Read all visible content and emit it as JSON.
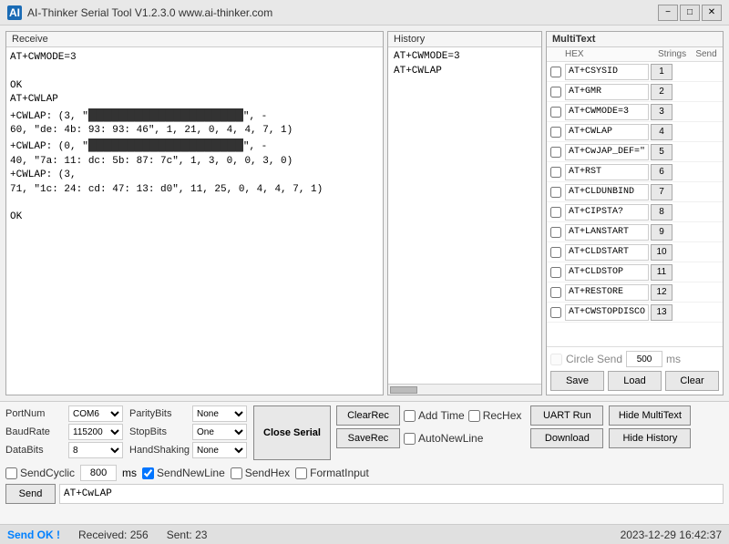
{
  "titleBar": {
    "title": "AI-Thinker Serial Tool V1.2.3.0   www.ai-thinker.com",
    "minimizeIcon": "−",
    "maximizeIcon": "□",
    "closeIcon": "✕"
  },
  "receive": {
    "panelTitle": "Receive",
    "content": "AT+CWMODE=3\r\n\r\nOK\r\nAT+CWLAP\r\n+CWLAP: (3, \"[REDACTED]\", -\r\n60, \"de: 4b: 93: 93: 46\", 1, 21, 0, 4, 4, 7, 1)\r\n+CWLAP: (0, \"[REDACTED]\", -\r\n40, \"7a: 11: dc: 5b: 87: 7c\", 1, 3, 0, 0, 3, 0)\r\n+CWLAP: (3,\r\n71, \"1c: 24: cd: 47: 13: d0\", 11, 25, 0, 4, 4, 7, 1)\r\n\r\nOK"
  },
  "history": {
    "panelTitle": "History",
    "items": [
      "AT+CWMODE=3",
      "AT+CWLAP"
    ]
  },
  "multitext": {
    "panelTitle": "MultiText",
    "colHex": "HEX",
    "colStrings": "Strings",
    "colSend": "Send",
    "rows": [
      {
        "hex": false,
        "value": "AT+CSYSID",
        "sendNum": "1"
      },
      {
        "hex": false,
        "value": "AT+GMR",
        "sendNum": "2"
      },
      {
        "hex": false,
        "value": "AT+CWMODE=3",
        "sendNum": "3"
      },
      {
        "hex": false,
        "value": "AT+CWLAP",
        "sendNum": "4"
      },
      {
        "hex": false,
        "value": "AT+CwJAP_DEF=\"newifi_",
        "sendNum": "5"
      },
      {
        "hex": false,
        "value": "AT+RST",
        "sendNum": "6"
      },
      {
        "hex": false,
        "value": "AT+CLDUNBIND",
        "sendNum": "7"
      },
      {
        "hex": false,
        "value": "AT+CIPSTA?",
        "sendNum": "8"
      },
      {
        "hex": false,
        "value": "AT+LANSTART",
        "sendNum": "9"
      },
      {
        "hex": false,
        "value": "AT+CLDSTART",
        "sendNum": "10"
      },
      {
        "hex": false,
        "value": "AT+CLDSTOP",
        "sendNum": "11"
      },
      {
        "hex": false,
        "value": "AT+RESTORE",
        "sendNum": "12"
      },
      {
        "hex": false,
        "value": "AT+CWSTOPDISCOVER",
        "sendNum": "13"
      }
    ],
    "circleSend": {
      "label": "Circle Send",
      "value": "500",
      "unit": "ms"
    },
    "buttons": {
      "save": "Save",
      "load": "Load",
      "clear": "Clear"
    }
  },
  "bottomControls": {
    "params": {
      "portNum": {
        "label": "PortNum",
        "value": "COM6"
      },
      "baudRate": {
        "label": "BaudRate",
        "value": "115200"
      },
      "dataBits": {
        "label": "DataBits",
        "value": "8"
      },
      "parityBits": {
        "label": "ParityBits",
        "value": "None"
      },
      "stopBits": {
        "label": "StopBits",
        "value": "One"
      },
      "handShaking": {
        "label": "HandShaking",
        "value": "None"
      }
    },
    "closeSerial": "Close Serial",
    "clearRec": "ClearRec",
    "saveRec": "SaveRec",
    "addTime": "Add Time",
    "recHex": "RecHex",
    "autoNewLine": "AutoNewLine",
    "uartRun": "UART Run",
    "download": "Download",
    "hideMultiText": "Hide MultiText",
    "hideHistory": "Hide History",
    "sendCyclic": "SendCyclic",
    "cyclicMs": "800",
    "msLabel": "ms",
    "sendNewLine": "SendNewLine",
    "sendNewLineChecked": true,
    "sendHex": "SendHex",
    "formatInput": "FormatInput",
    "sendBtn": "Send",
    "sendValue": "AT+CwLAP"
  },
  "statusBar": {
    "sendOk": "Send OK !",
    "received": "Received: 256",
    "sent": "Sent: 23",
    "datetime": "2023-12-29 16:42:37"
  }
}
